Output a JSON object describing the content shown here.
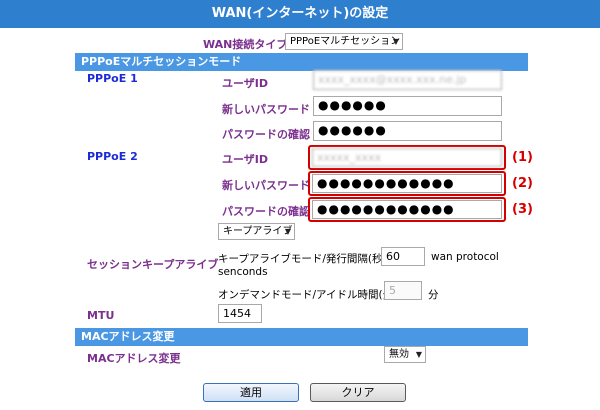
{
  "title": "WAN(インターネット)の設定",
  "wan_type": {
    "label": "WAN接続タイプ",
    "selected": "PPPoEマルチセッション"
  },
  "pppoe_section": {
    "header": "PPPoEマルチセッションモード",
    "pppoe1": {
      "label": "PPPoE 1",
      "user_id_label": "ユーザID",
      "user_id_value": "xxxx_xxxx@xxxx.xxx.ne.jp",
      "new_password_label": "新しいパスワード",
      "new_password_value": "●●●●●●",
      "confirm_password_label": "パスワードの確認",
      "confirm_password_value": "●●●●●●"
    },
    "pppoe2": {
      "label": "PPPoE 2",
      "user_id_label": "ユーザID",
      "user_id_value": "xxxxx_xxxx",
      "new_password_label": "新しいパスワード",
      "new_password_value": "●●●●●●●●●●●●",
      "confirm_password_label": "パスワードの確認",
      "confirm_password_value": "●●●●●●●●●●●●"
    },
    "markers": [
      "(1)",
      "(2)",
      "(3)"
    ],
    "keepalive_select": "キープアライブ",
    "session_keepalive": {
      "label": "セッションキープアライブ",
      "interval_label": "キープアライブモード/発行間隔(秒):",
      "interval_value": "60",
      "interval_suffix": "wan protocol",
      "interval_suffix2": "senconds",
      "idle_label": "オンデマンドモード/アイドル時間(分):",
      "idle_value": "5",
      "idle_unit": "分"
    },
    "mtu": {
      "label": "MTU",
      "value": "1454"
    }
  },
  "mac_section": {
    "header": "MACアドレス変更",
    "label": "MACアドレス変更",
    "selected": "無効"
  },
  "buttons": {
    "apply": "適用",
    "clear": "クリア"
  },
  "colors": {
    "title_bar": "#2f7fcf",
    "section_bar": "#4a97e3",
    "highlight": "#d40000"
  }
}
